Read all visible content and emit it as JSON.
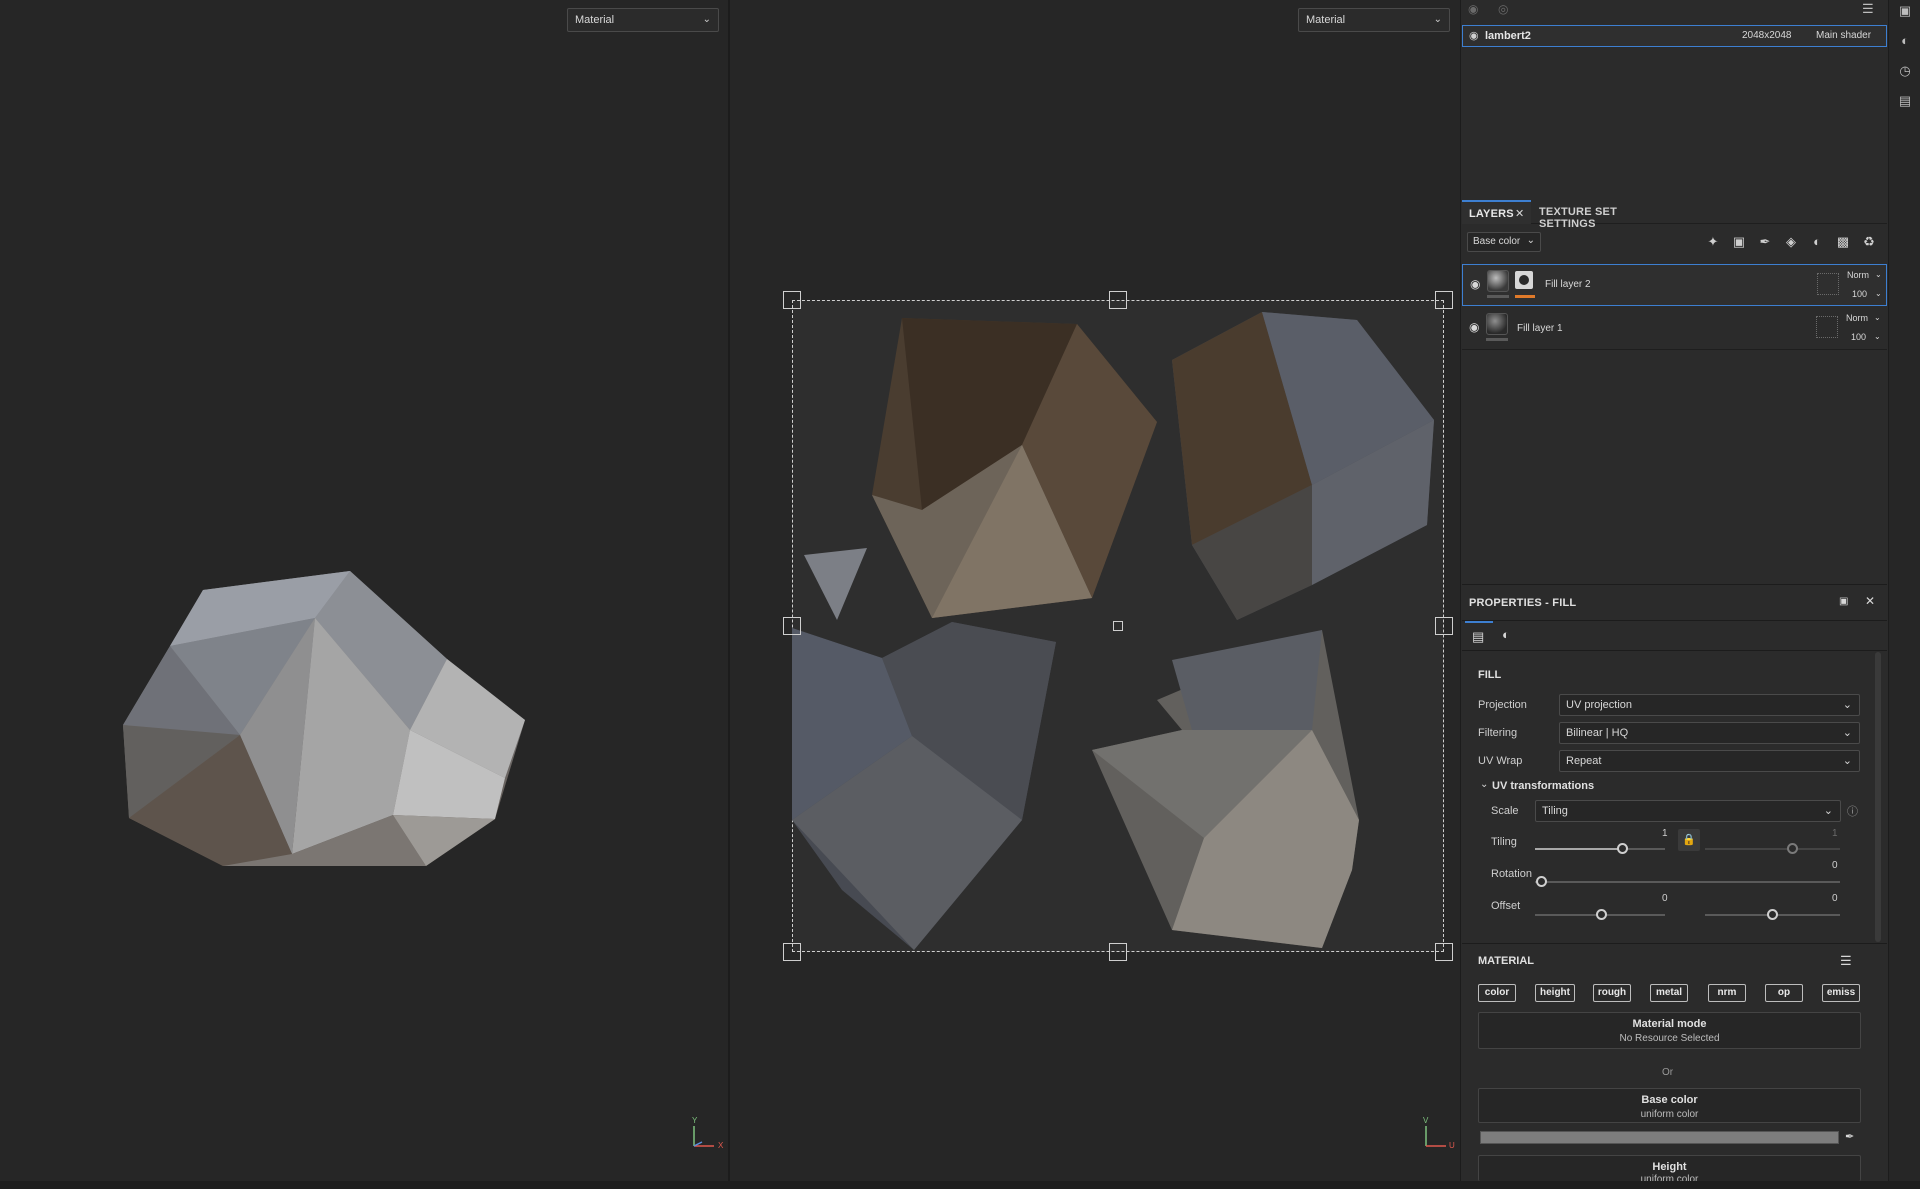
{
  "viewport_3d": {
    "mode_label": "Material",
    "axis_y": "Y",
    "axis_x": "X"
  },
  "viewport_uv": {
    "mode_label": "Material",
    "axis_v": "V",
    "axis_u": "U"
  },
  "texture_set": {
    "name": "lambert2",
    "resolution": "2048x2048",
    "shader": "Main shader"
  },
  "layers": {
    "tabs": [
      "LAYERS",
      "TEXTURE SET SETTINGS"
    ],
    "channel": "Base color",
    "items": [
      {
        "name": "Fill layer 2",
        "blend": "Norm",
        "opacity": "100",
        "selected": true
      },
      {
        "name": "Fill layer 1",
        "blend": "Norm",
        "opacity": "100",
        "selected": false
      }
    ]
  },
  "properties": {
    "title": "PROPERTIES - FILL",
    "fill_heading": "FILL",
    "projection_label": "Projection",
    "projection_value": "UV projection",
    "filtering_label": "Filtering",
    "filtering_value": "Bilinear | HQ",
    "uvwrap_label": "UV Wrap",
    "uvwrap_value": "Repeat",
    "uv_transform_heading": "UV transformations",
    "scale_label": "Scale",
    "scale_value": "Tiling",
    "tiling_label": "Tiling",
    "tiling_value_a": "1",
    "tiling_value_b": "1",
    "rotation_label": "Rotation",
    "rotation_value": "0",
    "offset_label": "Offset",
    "offset_value_a": "0",
    "offset_value_b": "0"
  },
  "material": {
    "heading": "MATERIAL",
    "chips": [
      "color",
      "height",
      "rough",
      "metal",
      "nrm",
      "op",
      "emiss"
    ],
    "mode_title": "Material mode",
    "mode_sub": "No Resource Selected",
    "or": "Or",
    "base_color_title": "Base color",
    "base_color_sub": "uniform color",
    "height_title": "Height",
    "height_sub": "uniform color"
  },
  "colors": {
    "accent": "#3d7fd1",
    "mask_orange": "#e07a2a",
    "panel_bg": "#2b2b2b",
    "viewport_bg": "#262626"
  }
}
